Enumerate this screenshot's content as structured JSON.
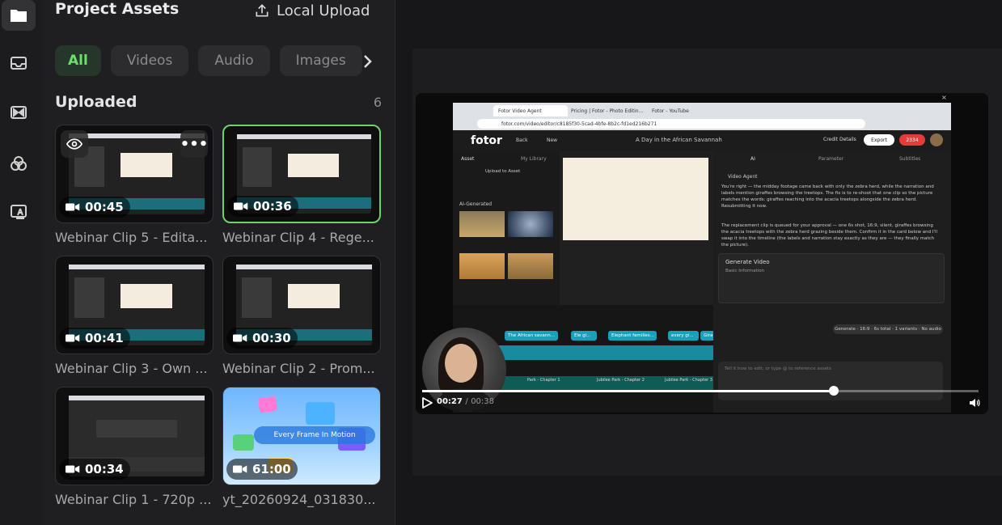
{
  "sidebar": {
    "items": [
      {
        "icon": "folder-icon",
        "active": true
      },
      {
        "icon": "inbox-icon",
        "active": false
      },
      {
        "icon": "transition-icon",
        "active": false
      },
      {
        "icon": "effects-icon",
        "active": false
      },
      {
        "icon": "text-image-icon",
        "active": false
      }
    ]
  },
  "panel": {
    "title": "Project Assets",
    "upload_label": "Local Upload",
    "filters": [
      "All",
      "Videos",
      "Audio",
      "Images"
    ],
    "active_filter": "All",
    "section_title": "Uploaded",
    "count": "6",
    "assets": [
      {
        "name": "Webinar Clip 5 - Edita...",
        "duration": "00:45",
        "selected": false,
        "hover": true
      },
      {
        "name": "Webinar Clip 4 - Rege...",
        "duration": "00:36",
        "selected": true,
        "hover": false
      },
      {
        "name": "Webinar Clip 3 - Own ...",
        "duration": "00:41",
        "selected": false,
        "hover": false
      },
      {
        "name": "Webinar Clip 2 - Prom...",
        "duration": "00:30",
        "selected": false,
        "hover": false
      },
      {
        "name": "Webinar Clip 1 - 720p ...",
        "duration": "00:34",
        "selected": false,
        "hover": false
      },
      {
        "name": "yt_20260924_031830...",
        "duration": "61:00",
        "selected": false,
        "hover": false
      }
    ]
  },
  "promo_text": "Every Frame In Motion",
  "player": {
    "current_time": "00:27",
    "separator": "/",
    "total_time": "00:38",
    "progress": 0.74
  },
  "recording": {
    "tabs": [
      "Fotor Video Agent",
      "Pricing | Fotor - Photo Editin...",
      "Fotor - YouTube"
    ],
    "address": "fotor.com/video/editor/c8185f30-5cad-4bfe-8b2c-fd1ed216b271",
    "logo": "fotor",
    "back": "Back",
    "new": "New",
    "doc_title": "A Day in the African Savannah",
    "credit": "Credit Details",
    "export": "Export",
    "credits": "2334",
    "asset_tab": "Asset",
    "library_tab": "My Library",
    "upload_asset": "Upload to Asset",
    "ai_generated": "AI-Generated",
    "agent_tabs": [
      "AI",
      "Parameter",
      "Subtitles"
    ],
    "agent_label": "Video Agent",
    "msg1": "You're right — the midday footage came back with only the zebra herd, while the narration and labels mention giraffes browsing the treetops. The fix is to re-shoot that one clip so the picture matches the words: giraffes reaching into the acacia treetops alongside the zebra herd. Resubmitting it now.",
    "msg2": "The replacement clip is queued for your approval — one 6s shot, 16:9, silent, giraffes browsing the acacia treetops with the zebra herd grazing beside them. Confirm it in the card below and I'll swap it into the timeline (the labels and narration stay exactly as they are — they finally match the picture).",
    "gen_title": "Generate Video",
    "gen_sub": "Basic Information",
    "gen_pill": "Generate · 16:9 · 6s total · 1 variants · No audio",
    "input_placeholder": "Tell it how to edit, or type @ to reference assets",
    "clips": [
      "The African savann...",
      "Ele gi...",
      "Elephant families...",
      "every gi...",
      "Gira..."
    ],
    "chapters": [
      "Park - Chapter 1",
      "Jubilee Park - Chapter 2",
      "Jubilee Park - Chapter 3"
    ]
  },
  "colors": {
    "accent": "#6ed36e",
    "background": "#1a1a1c",
    "panel": "#1f1f21"
  }
}
